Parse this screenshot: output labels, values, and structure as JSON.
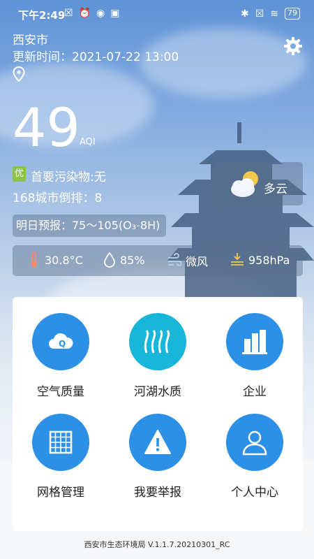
{
  "status_bar": {
    "time": "下午2:49",
    "battery": "79"
  },
  "header": {
    "city": "西安市",
    "update_label": "更新时间：",
    "update_time": "2021-07-22 13:00"
  },
  "aqi": {
    "value": "49",
    "unit": "AQI",
    "level_badge": "优",
    "primary_pollutant": "首要污染物:无",
    "rank": "168城市倒排：8"
  },
  "weather": {
    "condition": "多云",
    "forecast": "明日预报：75～105(O₃-8H)",
    "temperature": "30.8°C",
    "humidity": "85%",
    "wind": "微风",
    "pressure": "958hPa"
  },
  "menu": [
    {
      "label": "空气质量",
      "icon": "cloud-q-icon"
    },
    {
      "label": "河湖水质",
      "icon": "water-waves-icon"
    },
    {
      "label": "企业",
      "icon": "buildings-icon"
    },
    {
      "label": "网格管理",
      "icon": "grid-icon"
    },
    {
      "label": "我要举报",
      "icon": "warning-icon"
    },
    {
      "label": "个人中心",
      "icon": "user-icon"
    }
  ],
  "footer": "西安市生态环境局 V.1.1.7.20210301_RC",
  "colors": {
    "primary_blue": "#2b90e6",
    "teal": "#18b6d8",
    "good_green": "#8bc34a"
  }
}
